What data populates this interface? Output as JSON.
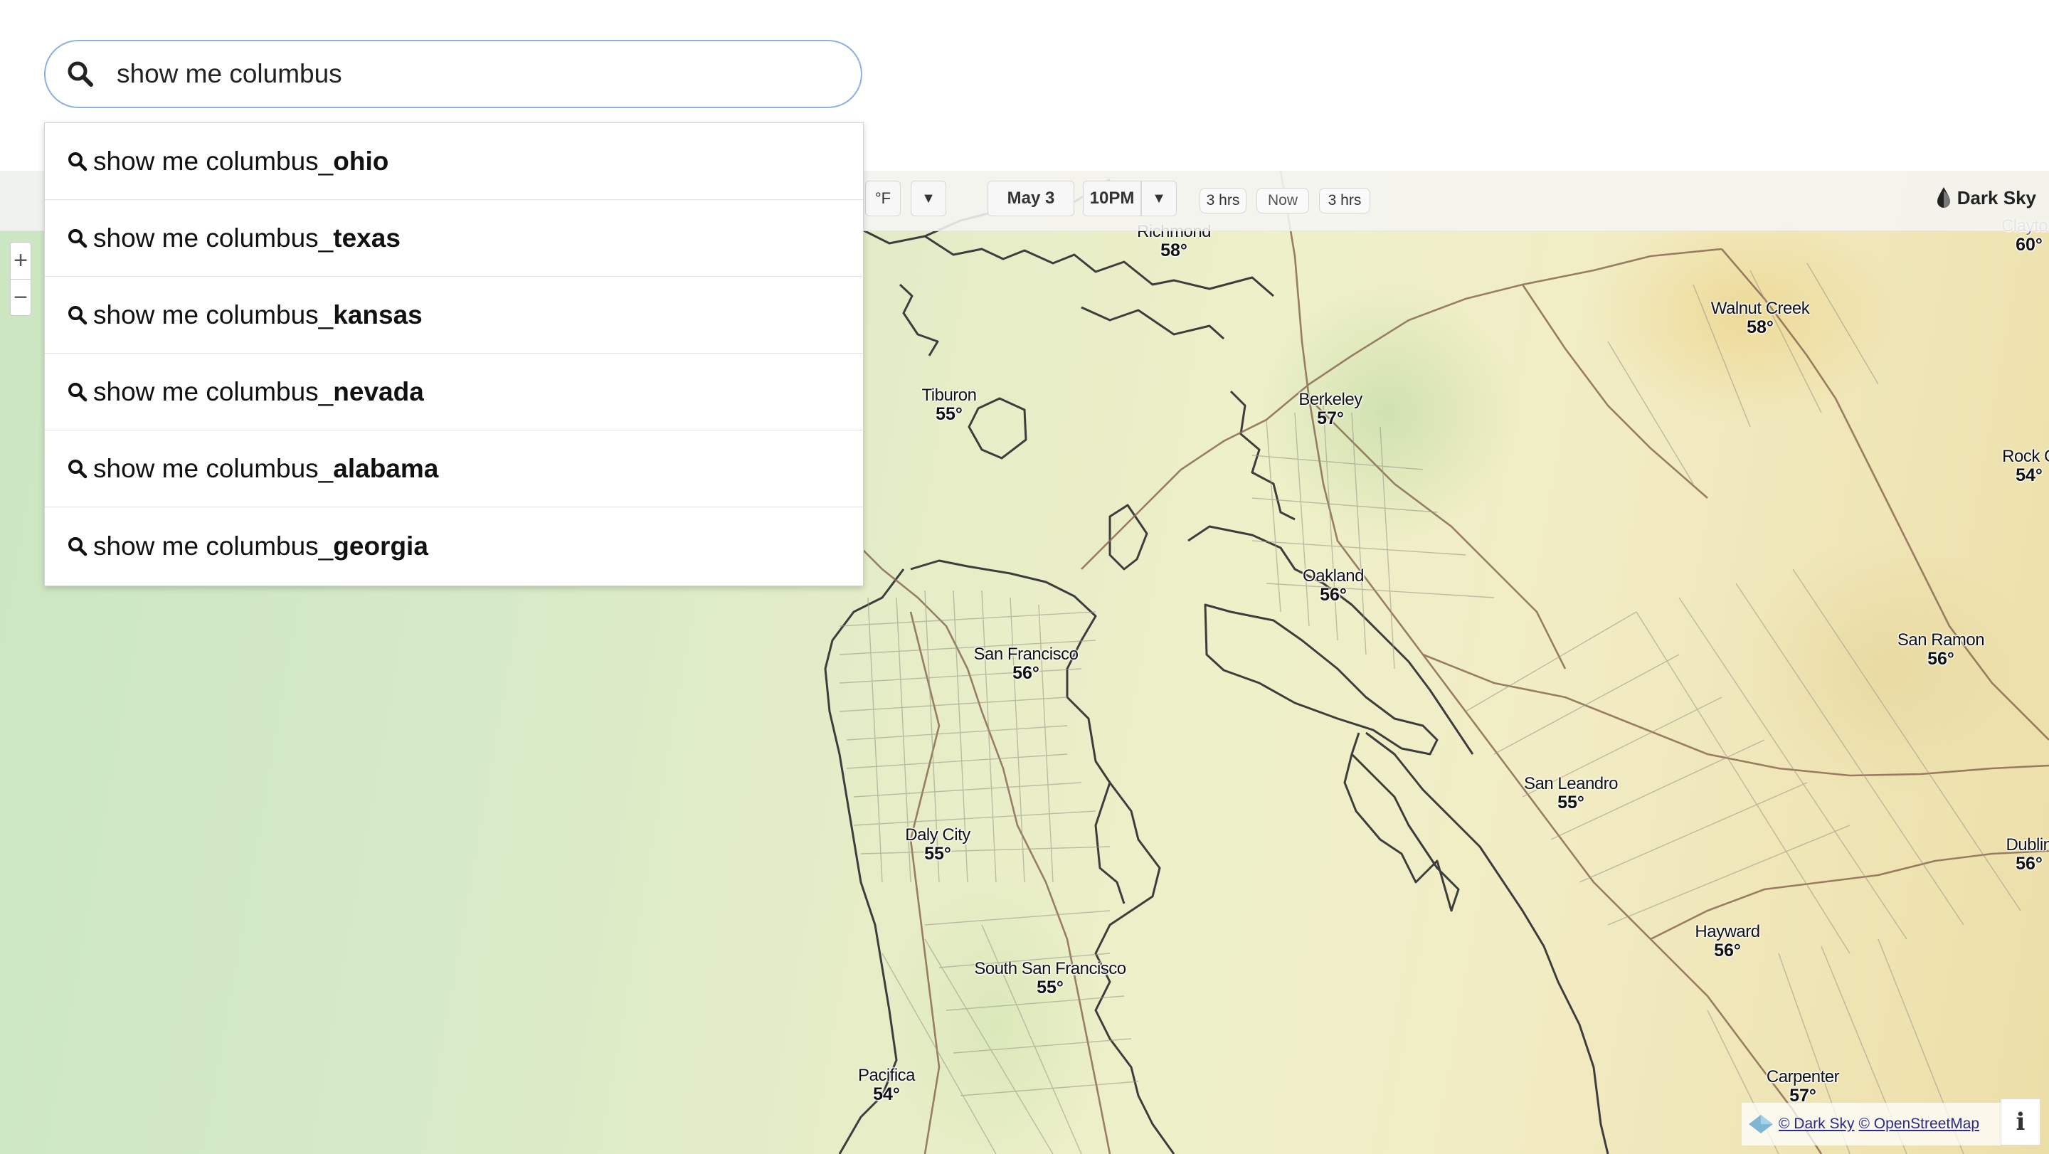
{
  "search": {
    "value": "show me columbus",
    "placeholder": "",
    "icon": "search-icon"
  },
  "suggestions": [
    {
      "prefix": "show me columbus_",
      "bold": "ohio"
    },
    {
      "prefix": "show me columbus_",
      "bold": "texas"
    },
    {
      "prefix": "show me columbus_",
      "bold": "kansas"
    },
    {
      "prefix": "show me columbus_",
      "bold": "nevada"
    },
    {
      "prefix": "show me columbus_",
      "bold": "alabama"
    },
    {
      "prefix": "show me columbus_",
      "bold": "georgia"
    }
  ],
  "toolbar": {
    "unit_label": "°F",
    "unit_dropdown": "▼",
    "date_label": "May 3",
    "time_label": "10PM",
    "time_dropdown": "▼",
    "back_label": "3 hrs",
    "now_label": "Now",
    "forward_label": "3 hrs",
    "brand_label": "Dark Sky"
  },
  "zoom": {
    "in_label": "+",
    "out_label": "−"
  },
  "attribution": {
    "darksky_link": "© Dark Sky",
    "osm_link": "© OpenStreetMap",
    "info_label": "i"
  },
  "cities": [
    {
      "name": "Richmond",
      "temp": "58°"
    },
    {
      "name": "Clayton",
      "temp": "60°"
    },
    {
      "name": "Walnut Creek",
      "temp": "58°"
    },
    {
      "name": "Tiburon",
      "temp": "55°"
    },
    {
      "name": "Berkeley",
      "temp": "57°"
    },
    {
      "name": "Rock C",
      "temp": "54°"
    },
    {
      "name": "Oakland",
      "temp": "56°"
    },
    {
      "name": "San Francisco",
      "temp": "56°"
    },
    {
      "name": "San Ramon",
      "temp": "56°"
    },
    {
      "name": "San Leandro",
      "temp": "55°"
    },
    {
      "name": "Daly City",
      "temp": "55°"
    },
    {
      "name": "Dublin",
      "temp": "56°"
    },
    {
      "name": "Hayward",
      "temp": "56°"
    },
    {
      "name": "South San Francisco",
      "temp": "55°"
    },
    {
      "name": "Pacifica",
      "temp": "54°"
    },
    {
      "name": "Carpenter",
      "temp": "57°"
    }
  ]
}
